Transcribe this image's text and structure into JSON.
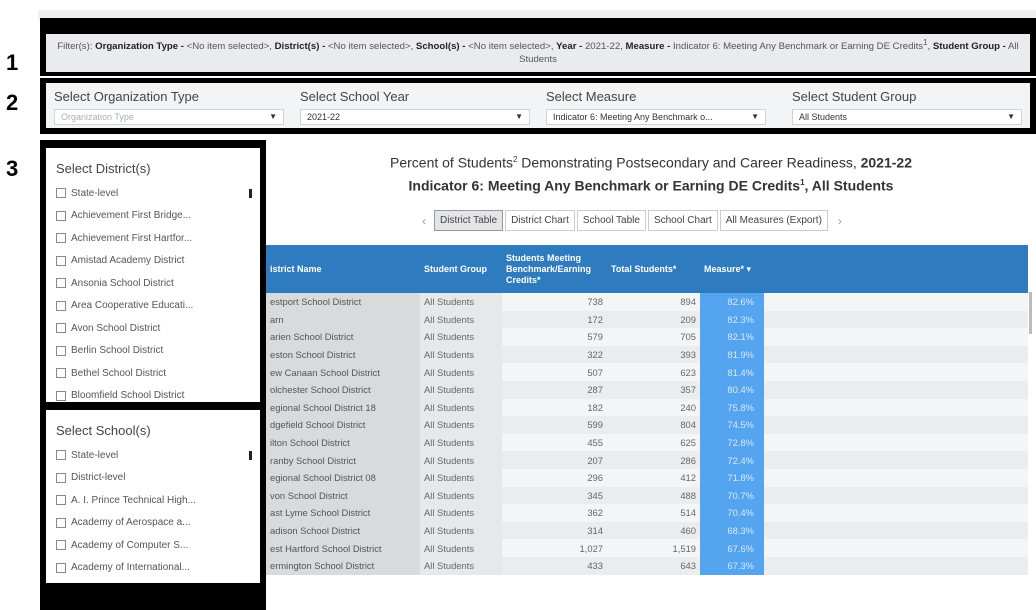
{
  "callouts": [
    "1",
    "2",
    "3"
  ],
  "filter_summary": {
    "prefix": "Filter(s): ",
    "org_type_key": "Organization Type -",
    "org_type_val": " <No item selected>, ",
    "district_key": "District(s) -",
    "district_val": " <No item selected>, ",
    "school_key": "School(s) -",
    "school_val": " <No item selected>, ",
    "year_key": "Year -",
    "year_val": " 2021-22, ",
    "measure_key": "Measure -",
    "measure_val": " Indicator 6: Meeting Any Benchmark or Earning DE Credits",
    "measure_sup": "1",
    "measure_sep": ", ",
    "group_key": "Student Group -",
    "group_val": " All Students"
  },
  "selectors": [
    {
      "label": "Select Organization Type",
      "value": "Organization Type",
      "placeholder": true
    },
    {
      "label": "Select School Year",
      "value": "2021-22",
      "placeholder": false
    },
    {
      "label": "Select Measure",
      "value": "Indicator 6: Meeting Any Benchmark o...",
      "placeholder": false
    },
    {
      "label": "Select Student Group",
      "value": "All Students",
      "placeholder": false
    }
  ],
  "district_panel": {
    "title": "Select District(s)",
    "items": [
      "State-level",
      "Achievement First Bridge...",
      "Achievement First Hartfor...",
      "Amistad Academy District",
      "Ansonia School District",
      "Area Cooperative Educati...",
      "Avon School District",
      "Berlin School District",
      "Bethel School District",
      "Bloomfield School District"
    ]
  },
  "school_panel": {
    "title": "Select School(s)",
    "items": [
      "State-level",
      "District-level",
      "A. I. Prince Technical High...",
      "Academy of Aerospace a...",
      "Academy of Computer S...",
      "Academy of International..."
    ]
  },
  "report": {
    "title_line1": "Percent of Students",
    "title_line1_sup": "2",
    "title_line1_rest": " Demonstrating Postsecondary and Career Readiness, ",
    "title_line1_year": "2021-22",
    "title_line2": "Indicator 6: Meeting Any Benchmark or Earning DE Credits",
    "title_line2_sup": "1",
    "title_line2_rest": ", All Students"
  },
  "tabs": {
    "prev": "‹",
    "next": "›",
    "items": [
      "District Table",
      "District Chart",
      "School Table",
      "School Chart",
      "All Measures (Export)"
    ],
    "active": 0
  },
  "table": {
    "headers": [
      "istrict Name",
      "Student Group",
      "Students Meeting Benchmark/Earning Credits*",
      "Total Students*",
      "Measure* ▾"
    ],
    "rows": [
      [
        "estport School District",
        "All Students",
        "738",
        "894",
        "82.6%"
      ],
      [
        "arn",
        "All Students",
        "172",
        "209",
        "82.3%"
      ],
      [
        "arien School District",
        "All Students",
        "579",
        "705",
        "82.1%"
      ],
      [
        "eston School District",
        "All Students",
        "322",
        "393",
        "81.9%"
      ],
      [
        "ew Canaan School District",
        "All Students",
        "507",
        "623",
        "81.4%"
      ],
      [
        "olchester School District",
        "All Students",
        "287",
        "357",
        "80.4%"
      ],
      [
        "egional School District 18",
        "All Students",
        "182",
        "240",
        "75.8%"
      ],
      [
        "dgefield School District",
        "All Students",
        "599",
        "804",
        "74.5%"
      ],
      [
        "ilton School District",
        "All Students",
        "455",
        "625",
        "72.8%"
      ],
      [
        "ranby School District",
        "All Students",
        "207",
        "286",
        "72.4%"
      ],
      [
        "egional School District 08",
        "All Students",
        "296",
        "412",
        "71.8%"
      ],
      [
        "von School District",
        "All Students",
        "345",
        "488",
        "70.7%"
      ],
      [
        "ast Lyme School District",
        "All Students",
        "362",
        "514",
        "70.4%"
      ],
      [
        "adison School District",
        "All Students",
        "314",
        "460",
        "68.3%"
      ],
      [
        "est Hartford School District",
        "All Students",
        "1,027",
        "1,519",
        "67.6%"
      ],
      [
        "ermington School District",
        "All Students",
        "433",
        "643",
        "67.3%"
      ]
    ]
  }
}
